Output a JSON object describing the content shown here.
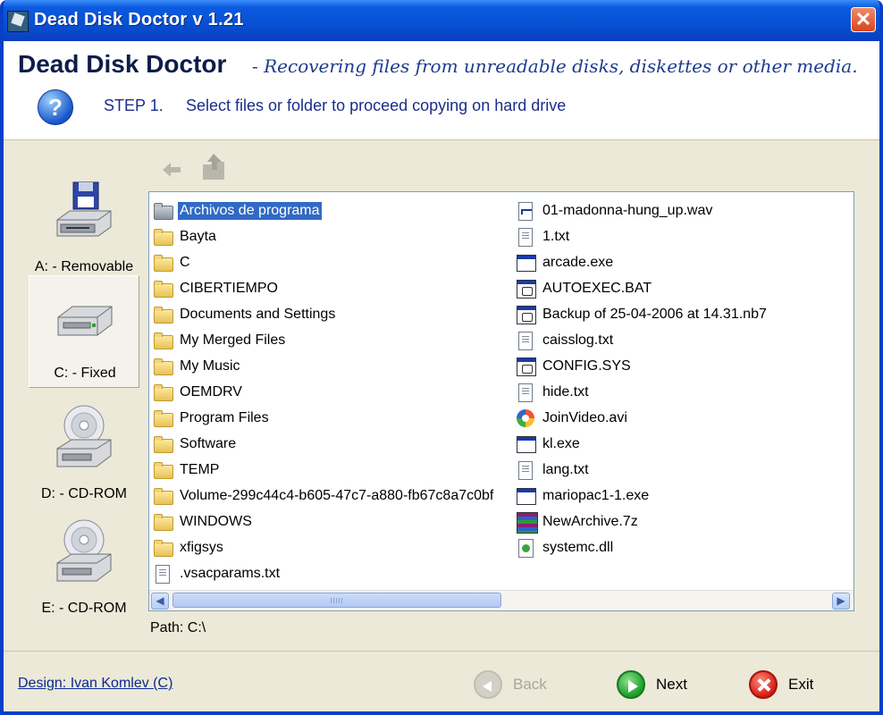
{
  "window": {
    "title": "Dead Disk Doctor   v 1.21"
  },
  "header": {
    "app_name": "Dead Disk Doctor",
    "tagline": "- Recovering files from unreadable disks, diskettes or other media.",
    "step_label": "STEP 1.",
    "step_text": "Select files or folder to proceed copying on hard drive"
  },
  "drives": [
    {
      "label": "A: - Removable",
      "icon": "floppy-drive-icon",
      "selected": false
    },
    {
      "label": "C: - Fixed",
      "icon": "hard-drive-icon",
      "selected": true
    },
    {
      "label": "D: - CD-ROM",
      "icon": "cdrom-drive-icon",
      "selected": false
    },
    {
      "label": "E: - CD-ROM",
      "icon": "cdrom-drive-icon",
      "selected": false
    }
  ],
  "files_col1": [
    {
      "name": "Archivos de programa",
      "type": "folder-sys",
      "selected": true
    },
    {
      "name": "Bayta",
      "type": "folder"
    },
    {
      "name": "C",
      "type": "folder"
    },
    {
      "name": "CIBERTIEMPO",
      "type": "folder"
    },
    {
      "name": "Documents and Settings",
      "type": "folder"
    },
    {
      "name": "My Merged Files",
      "type": "folder"
    },
    {
      "name": "My Music",
      "type": "folder"
    },
    {
      "name": "OEMDRV",
      "type": "folder"
    },
    {
      "name": "Program Files",
      "type": "folder"
    },
    {
      "name": "Software",
      "type": "folder"
    },
    {
      "name": "TEMP",
      "type": "folder"
    },
    {
      "name": "Volume-299c44c4-b605-47c7-a880-fb67c8a7c0bf",
      "type": "folder"
    },
    {
      "name": "WINDOWS",
      "type": "folder"
    },
    {
      "name": "xfigsys",
      "type": "folder"
    },
    {
      "name": ".vsacparams.txt",
      "type": "txt"
    }
  ],
  "files_col2": [
    {
      "name": "01-madonna-hung_up.wav",
      "type": "wav"
    },
    {
      "name": "1.txt",
      "type": "txt"
    },
    {
      "name": "arcade.exe",
      "type": "exe"
    },
    {
      "name": "AUTOEXEC.BAT",
      "type": "bat"
    },
    {
      "name": "Backup of 25-04-2006 at 14.31.nb7",
      "type": "bat"
    },
    {
      "name": "caisslog.txt",
      "type": "txt"
    },
    {
      "name": "CONFIG.SYS",
      "type": "bat"
    },
    {
      "name": "hide.txt",
      "type": "txt"
    },
    {
      "name": "JoinVideo.avi",
      "type": "avi"
    },
    {
      "name": "kl.exe",
      "type": "exe"
    },
    {
      "name": "lang.txt",
      "type": "txt"
    },
    {
      "name": "mariopac1-1.exe",
      "type": "exe"
    },
    {
      "name": "NewArchive.7z",
      "type": "zip"
    },
    {
      "name": "systemc.dll",
      "type": "dll"
    }
  ],
  "path": "Path: C:\\",
  "footer": {
    "design_link": "Design: Ivan Komlev (C)",
    "back_label": "Back",
    "next_label": "Next",
    "exit_label": "Exit"
  },
  "colors": {
    "title_bar": "#0850d2",
    "selection": "#316ac5",
    "dialog_bg": "#ece9d8"
  }
}
